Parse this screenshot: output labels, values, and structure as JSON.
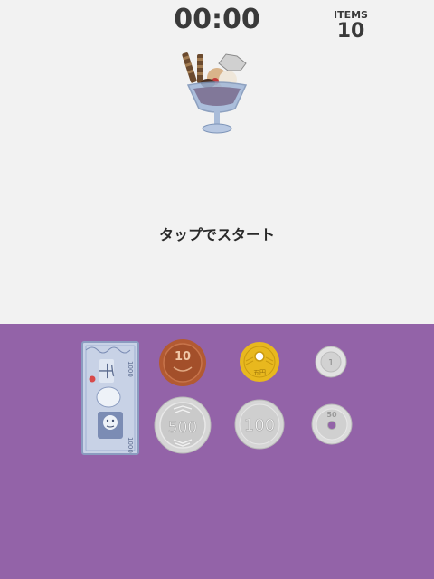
{
  "hud": {
    "timer": "00:00",
    "items_label": "ITEMS",
    "items_count": "10"
  },
  "prompt": {
    "start_text": "タップでスタート"
  },
  "money": {
    "bill": {
      "icon": "bill-1000-icon",
      "label": "1000",
      "kanji": "千"
    },
    "coin_10": {
      "icon": "coin-10-icon",
      "label": "10"
    },
    "coin_5": {
      "icon": "coin-5-icon",
      "label": "五円"
    },
    "coin_1": {
      "icon": "coin-1-icon",
      "label": "1"
    },
    "coin_500": {
      "icon": "coin-500-icon",
      "label": "500"
    },
    "coin_100": {
      "icon": "coin-100-icon",
      "label": "100"
    },
    "coin_50": {
      "icon": "coin-50-icon",
      "label": "50"
    }
  },
  "colors": {
    "top_background": "#f2f2f2",
    "money_tray": "#9363a8",
    "coin_10": "#b25a32",
    "coin_5": "#e8b81e",
    "silver_coin": "#d6d6d6"
  }
}
